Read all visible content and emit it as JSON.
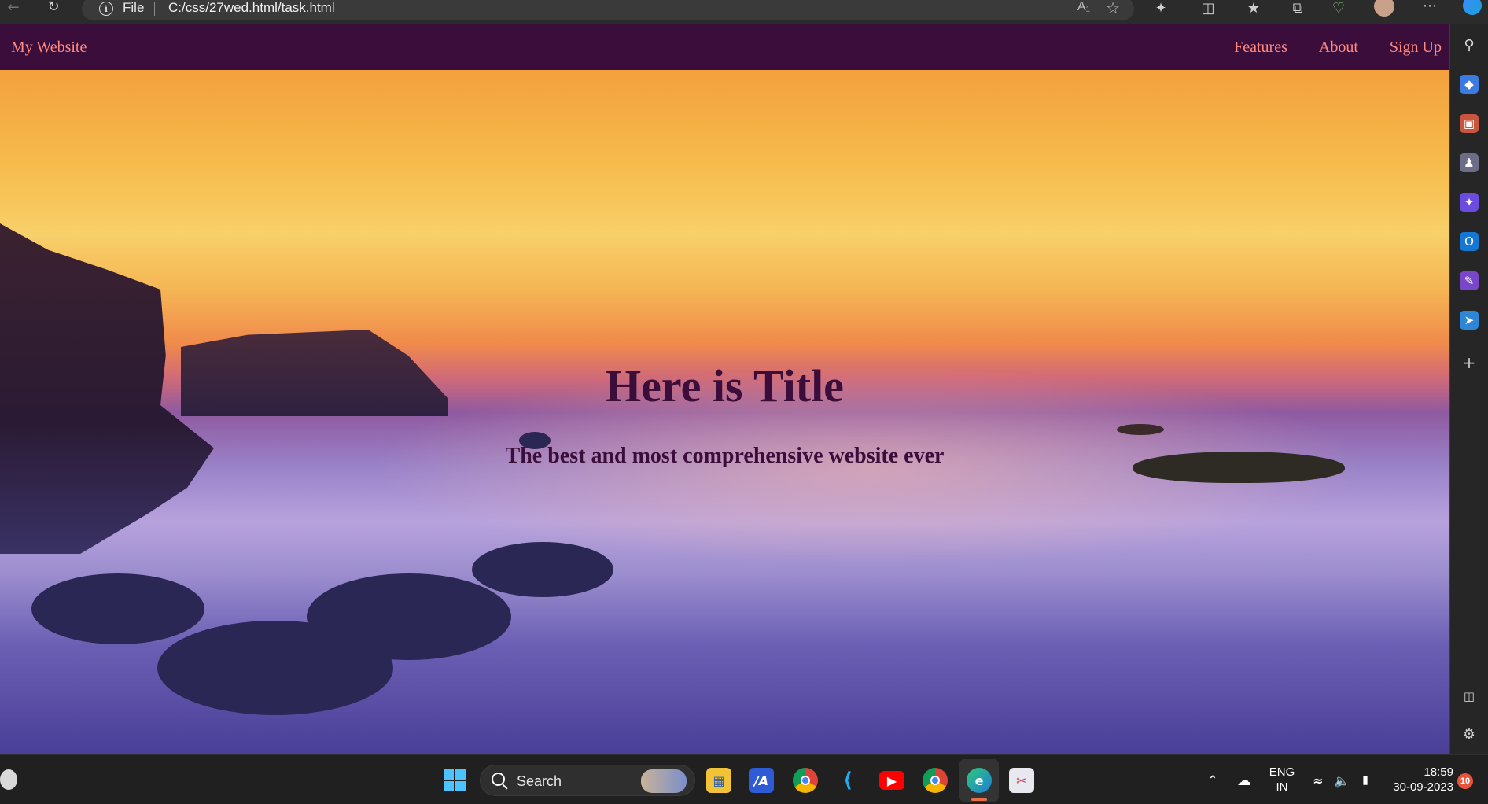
{
  "browser": {
    "back_icon": "back-arrow-icon",
    "refresh_icon": "refresh-icon",
    "scheme": "File",
    "url": "C:/css/27wed.html/task.html",
    "read_aloud": "Ă",
    "toolbar_icons": [
      "extensions-icon",
      "split-screen-icon",
      "favorites-icon",
      "collections-icon",
      "heartbeat-icon",
      "profile-icon",
      "more-icon",
      "copilot-icon"
    ]
  },
  "site": {
    "brand": "My Website",
    "nav": [
      "Features",
      "About",
      "Sign Up"
    ],
    "hero_title": "Here is Title",
    "hero_subtitle": "The best and most comprehensive website ever",
    "accent_color": "#ff8a80",
    "nav_bg": "#3a0d3b"
  },
  "sidebar": {
    "icons": [
      "search-icon",
      "tag-icon",
      "briefcase-icon",
      "games-icon",
      "copilot-icon",
      "outlook-icon",
      "designer-icon",
      "send-icon",
      "add-icon"
    ],
    "bottom_icons": [
      "sidebar-toggle-icon",
      "settings-icon"
    ]
  },
  "taskbar": {
    "search_label": "Search",
    "language": "ENG",
    "region": "IN",
    "time": "18:59",
    "date": "30-09-2023",
    "notification_count": "10"
  }
}
